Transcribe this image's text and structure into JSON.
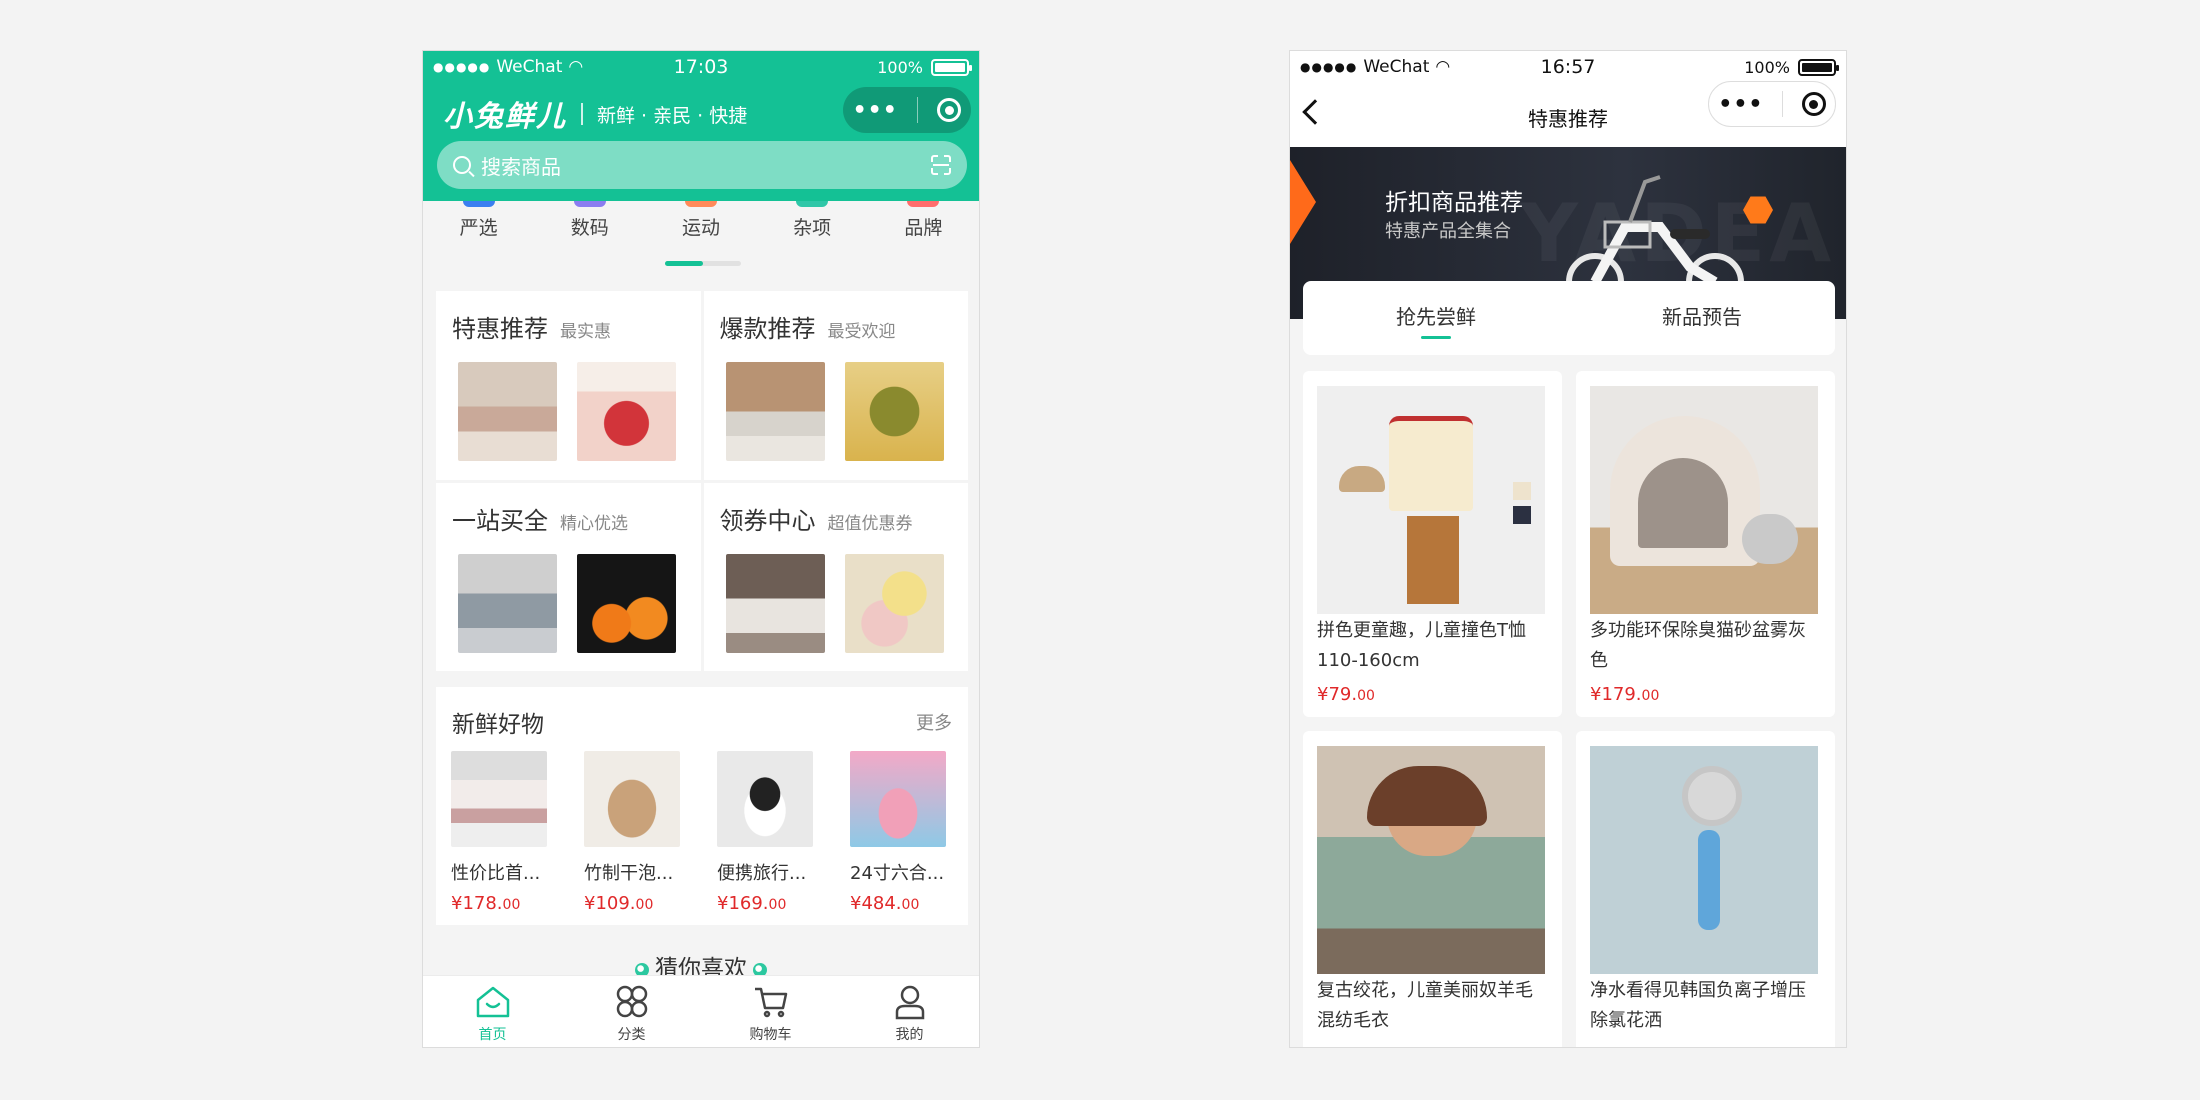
{
  "left": {
    "status": {
      "carrier": "WeChat",
      "time": "17:03",
      "battery": "100%"
    },
    "header": {
      "logo": "小兔鲜儿",
      "slogan": "新鲜 · 亲民 · 快捷"
    },
    "search": {
      "placeholder": "搜索商品"
    },
    "categories": [
      "严选",
      "数码",
      "运动",
      "杂项",
      "品牌"
    ],
    "promos": [
      {
        "title": "特惠推荐",
        "subtitle": "最实惠"
      },
      {
        "title": "爆款推荐",
        "subtitle": "最受欢迎"
      },
      {
        "title": "一站买全",
        "subtitle": "精心优选"
      },
      {
        "title": "领券中心",
        "subtitle": "超值优惠券"
      }
    ],
    "fresh": {
      "title": "新鲜好物",
      "more": "更多",
      "items": [
        {
          "name": "性价比首...",
          "price": "¥178.",
          "cents": "00"
        },
        {
          "name": "竹制干泡...",
          "price": "¥109.",
          "cents": "00"
        },
        {
          "name": "便携旅行...",
          "price": "¥169.",
          "cents": "00"
        },
        {
          "name": "24寸六合...",
          "price": "¥484.",
          "cents": "00"
        }
      ]
    },
    "guess": "猜你喜欢",
    "tabbar": [
      "首页",
      "分类",
      "购物车",
      "我的"
    ]
  },
  "right": {
    "status": {
      "carrier": "WeChat",
      "time": "16:57",
      "battery": "100%"
    },
    "nav_title": "特惠推荐",
    "banner": {
      "title": "折扣商品推荐",
      "subtitle": "特惠产品全集合"
    },
    "tabs": [
      "抢先尝鲜",
      "新品预告"
    ],
    "goods": [
      {
        "name": "拼色更童趣，儿童撞色T恤110-160cm",
        "price": "¥79.",
        "cents": "00"
      },
      {
        "name": "多功能环保除臭猫砂盆雾灰色",
        "price": "¥179.",
        "cents": "00"
      },
      {
        "name": "复古绞花，儿童美丽奴羊毛混纺毛衣",
        "price": "",
        "cents": ""
      },
      {
        "name": "净水看得见韩国负离子增压除氯花洒",
        "price": "",
        "cents": ""
      }
    ]
  },
  "colors": {
    "brand": "#14c195",
    "price": "#e0292a"
  }
}
